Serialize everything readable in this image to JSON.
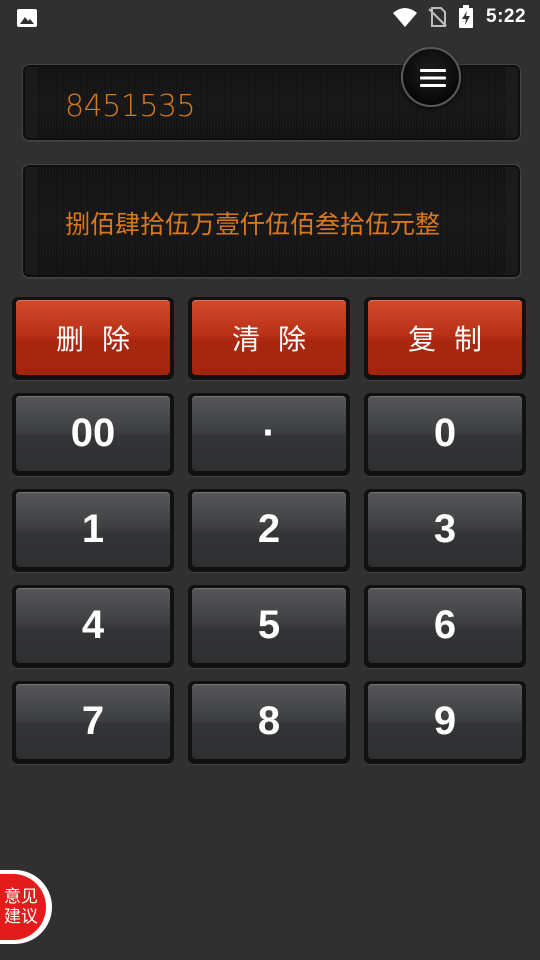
{
  "status_bar": {
    "time": "5:22",
    "icons": [
      "gallery-icon",
      "wifi-icon",
      "no-sim-icon",
      "battery-charging-icon"
    ]
  },
  "display": {
    "number": "8451535",
    "chinese": "捌佰肆拾伍万壹仟伍佰叁拾伍元整"
  },
  "menu": {
    "icon": "hamburger-menu-icon"
  },
  "actions": {
    "delete": "删除",
    "clear": "清除",
    "copy": "复制"
  },
  "keys": {
    "double_zero": "00",
    "dot": "·",
    "zero": "0",
    "one": "1",
    "two": "2",
    "three": "3",
    "four": "4",
    "five": "5",
    "six": "6",
    "seven": "7",
    "eight": "8",
    "nine": "9"
  },
  "feedback": {
    "line1": "意见",
    "line2": "建议"
  },
  "colors": {
    "display_text": "#d9781d",
    "action_key": "#b93218",
    "feedback_badge": "#e31b1b",
    "background": "#303031"
  }
}
